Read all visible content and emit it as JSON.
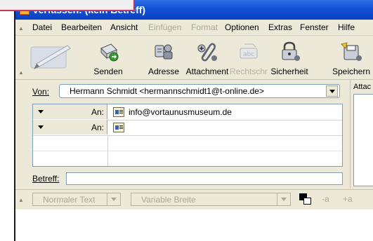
{
  "window": {
    "title": "Verfassen: (kein Betreff)",
    "title_color": "#1150d6"
  },
  "menu": {
    "items": [
      {
        "label": "Datei",
        "disabled": false
      },
      {
        "label": "Bearbeiten",
        "disabled": false
      },
      {
        "label": "Ansicht",
        "disabled": false
      },
      {
        "label": "Einfügen",
        "disabled": true
      },
      {
        "label": "Format",
        "disabled": true
      },
      {
        "label": "Optionen",
        "disabled": false
      },
      {
        "label": "Extras",
        "disabled": false
      },
      {
        "label": "Fenster",
        "disabled": false
      },
      {
        "label": "Hilfe",
        "disabled": false
      }
    ]
  },
  "toolbar": {
    "buttons": [
      {
        "label": "Senden",
        "icon": "send-icon",
        "disabled": false
      },
      {
        "label": "Adresse",
        "icon": "address-book-icon",
        "disabled": false
      },
      {
        "label": "Attachment",
        "icon": "paperclip-icon",
        "disabled": false
      },
      {
        "label": "Rechtschr",
        "icon": "spellcheck-icon",
        "disabled": true
      },
      {
        "label": "Sicherheit",
        "icon": "lock-icon",
        "disabled": false
      },
      {
        "label": "Speichern",
        "icon": "save-icon",
        "disabled": false
      }
    ]
  },
  "from": {
    "label": "Von:",
    "value": "Hermann Schmidt <hermannschmidt1@t-online.de>"
  },
  "recipients": [
    {
      "type": "An:",
      "address": "info@vortaunusmuseum.de"
    },
    {
      "type": "An:",
      "address": ""
    }
  ],
  "subject": {
    "label": "Betreff:",
    "value": ""
  },
  "attachments": {
    "label": "Attac"
  },
  "format_bar": {
    "paragraph_style": "Normaler Text",
    "font": "Variable Breite",
    "smaller_label": "-a",
    "larger_label": "+a",
    "text_color": "#000000",
    "background_color": "#ffffff"
  }
}
